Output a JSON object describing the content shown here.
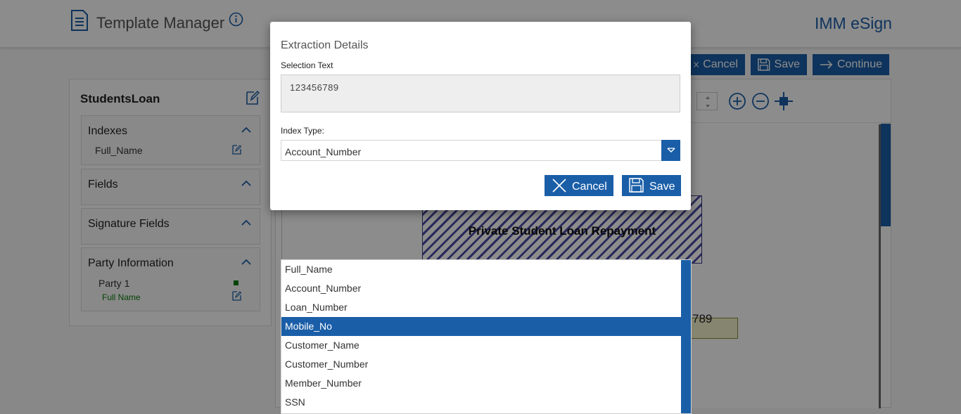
{
  "header": {
    "app_title": "Template Manager",
    "brand": "IMM eSign",
    "icons": {
      "app": "document-list-icon",
      "info": "info-icon"
    }
  },
  "toolbar": {
    "cancel_label": "Cancel",
    "save_label": "Save",
    "continue_label": "Continue"
  },
  "sidebar": {
    "template_name": "StudentsLoan",
    "sections": {
      "indexes": {
        "title": "Indexes",
        "items": [
          "Full_Name"
        ]
      },
      "fields": {
        "title": "Fields"
      },
      "signature_fields": {
        "title": "Signature Fields"
      },
      "party_information": {
        "title": "Party Information",
        "party": "Party 1",
        "party_field": "Full Name"
      }
    }
  },
  "document": {
    "heading": "Private Student Loan Repayment",
    "field_value": "789"
  },
  "modal": {
    "title": "Extraction Details",
    "selection_text_label": "Selection Text",
    "selection_text_value": "123456789",
    "index_type_label": "Index Type:",
    "index_type_value": "Account_Number",
    "cancel_label": "Cancel",
    "save_label": "Save"
  },
  "dropdown": {
    "options": [
      "Full_Name",
      "Account_Number",
      "Loan_Number",
      "Mobile_No",
      "Customer_Name",
      "Customer_Number",
      "Member_Number",
      "SSN"
    ],
    "highlighted": "Mobile_No"
  },
  "colors": {
    "accent": "#1a5ea8",
    "party_green": "#0a7a0a"
  }
}
